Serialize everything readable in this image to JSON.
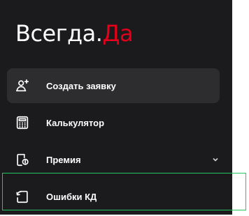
{
  "logo": {
    "part1": "Всегда.",
    "part2": "Да"
  },
  "colors": {
    "sidebar_bg": "#1b1b1d",
    "active_bg": "#2d2d30",
    "brand_red": "#e3001b",
    "highlight_green": "#22c55e"
  },
  "menu": {
    "items": [
      {
        "label": "Создать заявку",
        "icon": "add-user-icon",
        "active": true
      },
      {
        "label": "Калькулятор",
        "icon": "calculator-icon",
        "active": false
      },
      {
        "label": "Премия",
        "icon": "document-coin-icon",
        "active": false,
        "has_submenu": true
      },
      {
        "label": "Ошибки КД",
        "icon": "refresh-document-icon",
        "active": false
      }
    ]
  }
}
